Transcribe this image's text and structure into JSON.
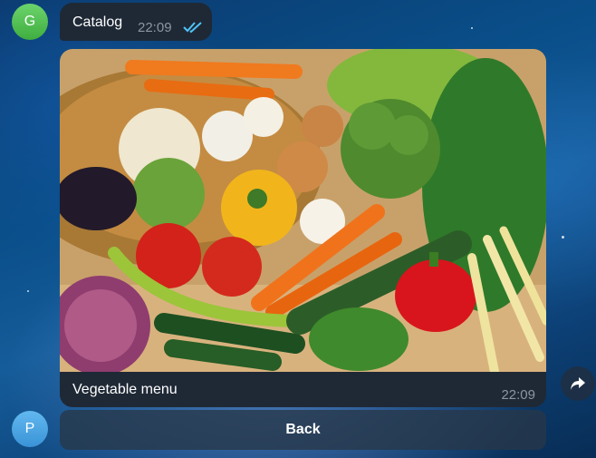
{
  "messages": {
    "top": {
      "text": "Catalog",
      "time": "22:09",
      "status_icon": "double-check-icon"
    },
    "photo": {
      "caption": "Vegetable menu",
      "time": "22:09",
      "image_alt": "Assortment of fresh vegetables"
    }
  },
  "avatars": {
    "top": "G",
    "bottom": "P"
  },
  "keyboard": {
    "back_label": "Back"
  },
  "colors": {
    "bubble": "#1f2936",
    "check": "#4fc3f7",
    "avatar_g": "#4cc14c",
    "avatar_p": "#4aa6e6"
  }
}
